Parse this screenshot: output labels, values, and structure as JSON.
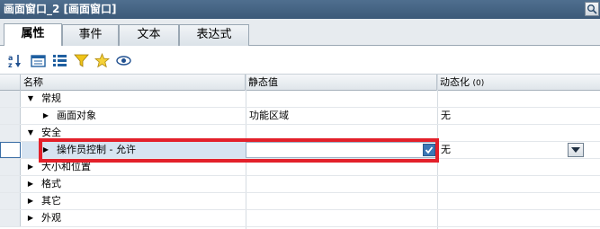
{
  "window": {
    "title": "画面窗口_2 [画面窗口]",
    "corner_icon": "zoom-icon"
  },
  "tabs": [
    {
      "label": "属性",
      "active": true
    },
    {
      "label": "事件",
      "active": false
    },
    {
      "label": "文本",
      "active": false
    },
    {
      "label": "表达式",
      "active": false
    }
  ],
  "toolbar": {
    "icons": [
      "sort-az-icon",
      "group-icon",
      "list-icon",
      "filter-icon",
      "favorite-star-icon",
      "view-eye-icon"
    ]
  },
  "grid": {
    "columns": {
      "name": "名称",
      "static": "静态值",
      "dynamic": "动态化",
      "dynamic_count": "(0)"
    },
    "rows": [
      {
        "name": "常规",
        "level": 0,
        "expanded": true,
        "static": "",
        "dynamic": ""
      },
      {
        "name": "画面对象",
        "level": 1,
        "expanded": false,
        "static": "功能区域",
        "dynamic": "无"
      },
      {
        "name": "安全",
        "level": 0,
        "expanded": true,
        "static": "",
        "dynamic": ""
      },
      {
        "name": "操作员控制 - 允许",
        "level": 1,
        "expanded": false,
        "static": "",
        "checked": true,
        "dynamic": "无",
        "selected": true
      },
      {
        "name": "大小和位置",
        "level": 0,
        "expanded": false,
        "static": "",
        "dynamic": ""
      },
      {
        "name": "格式",
        "level": 0,
        "expanded": false,
        "static": "",
        "dynamic": ""
      },
      {
        "name": "其它",
        "level": 0,
        "expanded": false,
        "static": "",
        "dynamic": ""
      },
      {
        "name": "外观",
        "level": 0,
        "expanded": false,
        "static": "",
        "dynamic": ""
      }
    ]
  },
  "colors": {
    "highlight": "#e3202a",
    "title_bar": "#4f6f8f",
    "checkbox": "#3b77b6"
  }
}
